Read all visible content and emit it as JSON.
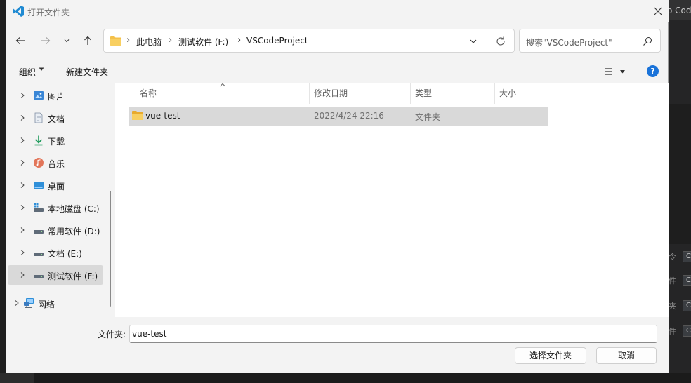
{
  "background_app": {
    "title_fragment": "o Code",
    "shortcut_rows": [
      {
        "glyph": "令",
        "key": "C"
      },
      {
        "glyph": "件",
        "key": "C"
      },
      {
        "glyph": "夹",
        "key": "C"
      },
      {
        "glyph": "件",
        "key": "C"
      }
    ]
  },
  "dialog": {
    "title": "打开文件夹",
    "address": {
      "crumbs": [
        "此电脑",
        "测试软件 (F:)",
        "VSCodeProject"
      ],
      "separator": "›"
    },
    "search": {
      "placeholder": "搜索\"VSCodeProject\""
    },
    "toolbar": {
      "organize_label": "组织",
      "new_folder_label": "新建文件夹",
      "help_label": "?"
    },
    "nav_items": [
      {
        "label": "图片",
        "icon": "pictures-icon"
      },
      {
        "label": "文档",
        "icon": "documents-icon"
      },
      {
        "label": "下载",
        "icon": "downloads-icon"
      },
      {
        "label": "音乐",
        "icon": "music-icon"
      },
      {
        "label": "桌面",
        "icon": "desktop-icon"
      },
      {
        "label": "本地磁盘 (C:)",
        "icon": "system-drive-icon"
      },
      {
        "label": "常用软件 (D:)",
        "icon": "drive-icon"
      },
      {
        "label": "文档 (E:)",
        "icon": "drive-icon"
      },
      {
        "label": "测试软件 (F:)",
        "icon": "drive-icon",
        "selected": true
      },
      {
        "label": "网络",
        "icon": "network-icon"
      }
    ],
    "columns": [
      "名称",
      "修改日期",
      "类型",
      "大小"
    ],
    "rows": [
      {
        "name": "vue-test",
        "date": "2022/4/24 22:16",
        "type": "文件夹",
        "size": ""
      }
    ],
    "footer": {
      "folder_label": "文件夹:",
      "folder_value": "vue-test",
      "select_label": "选择文件夹",
      "cancel_label": "取消"
    },
    "colors": {
      "accent": "#1a73d9",
      "folder": "#f4c04a",
      "selection": "#d9d9d9",
      "vscode_blue": "#1f8ad2"
    }
  }
}
